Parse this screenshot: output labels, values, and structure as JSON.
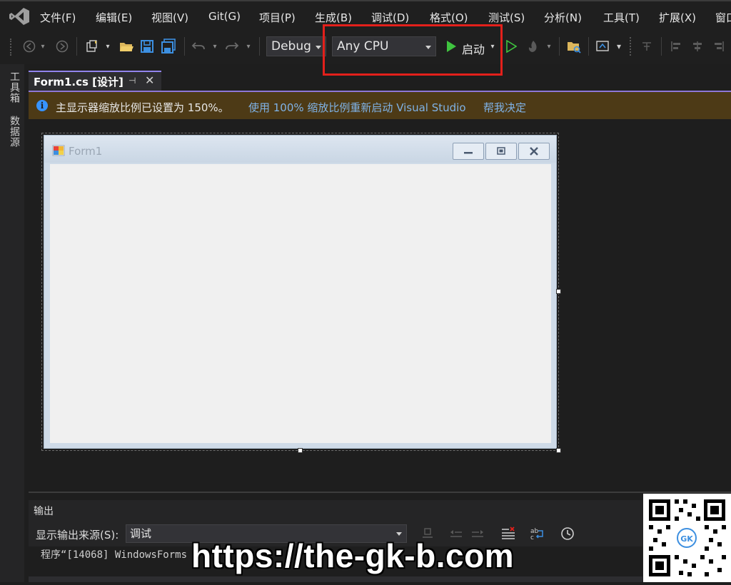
{
  "menu": {
    "items": [
      "文件(F)",
      "编辑(E)",
      "视图(V)",
      "Git(G)",
      "项目(P)",
      "生成(B)",
      "调试(D)",
      "格式(O)",
      "测试(S)",
      "分析(N)",
      "工具(T)",
      "扩展(X)",
      "窗口"
    ]
  },
  "toolbar": {
    "config": "Debug",
    "platform": "Any CPU",
    "start_label": "启动"
  },
  "rail": {
    "toolbox": "工具箱",
    "datasource": "数据源"
  },
  "tab": {
    "label": "Form1.cs [设计]"
  },
  "infobar": {
    "message": "主显示器缩放比例已设置为 150%。",
    "link_restart": "使用 100% 缩放比例重新启动 Visual Studio",
    "link_help": "帮我决定"
  },
  "form": {
    "title": "Form1"
  },
  "output": {
    "title": "输出",
    "source_label": "显示输出来源(S):",
    "source_value": "调试",
    "line": "程序“[14068] WindowsForms"
  },
  "watermark": {
    "text": "https://the-gk-b.com",
    "qr_label": "GK"
  },
  "colors": {
    "accent": "#9184ee",
    "highlight": "#e3201b",
    "run_green": "#3fc43f",
    "link": "#7fb2e6",
    "infobar_bg": "#4d3a16"
  }
}
